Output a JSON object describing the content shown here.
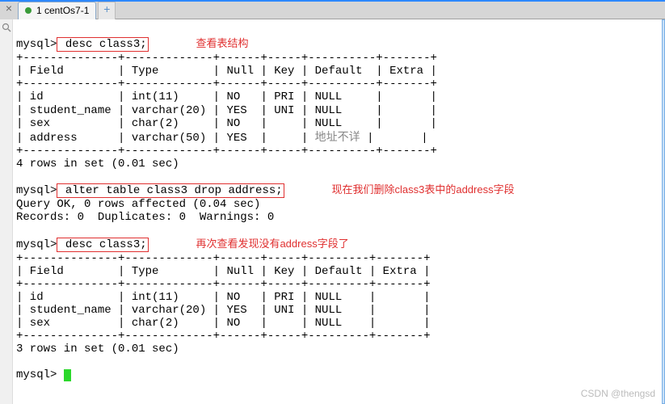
{
  "tab": {
    "label": "1 centOs7-1",
    "close": "×",
    "add": "+"
  },
  "prompts": {
    "p1": "mysql>",
    "p2": "mysql>",
    "p3": "mysql>",
    "p4": "mysql>"
  },
  "cmd1": " desc class3;",
  "anno1": "查看表结构",
  "table1": {
    "sep": "+--------------+-------------+------+-----+----------+-------+",
    "hdr": "| Field        | Type        | Null | Key | Default  | Extra |",
    "rows": [
      "| id           | int(11)     | NO   | PRI | NULL     |       |",
      "| student_name | varchar(20) | YES  | UNI | NULL     |       |",
      "| sex          | char(2)     | NO   |     | NULL     |       |"
    ],
    "row4_pre": "| address      | varchar(50) | YES  |     | ",
    "row4_def": "地址不详",
    "row4_post": " |       |"
  },
  "status1": "4 rows in set (0.01 sec)",
  "cmd2": " alter table class3 drop address;",
  "anno2": "现在我们删除class3表中的address字段",
  "result2a": "Query OK, 0 rows affected (0.04 sec)",
  "result2b": "Records: 0  Duplicates: 0  Warnings: 0",
  "cmd3": " desc class3;",
  "anno3": "再次查看发现没有address字段了",
  "table2": {
    "sep": "+--------------+-------------+------+-----+---------+-------+",
    "hdr": "| Field        | Type        | Null | Key | Default | Extra |",
    "rows": [
      "| id           | int(11)     | NO   | PRI | NULL    |       |",
      "| student_name | varchar(20) | YES  | UNI | NULL    |       |",
      "| sex          | char(2)     | NO   |     | NULL    |       |"
    ]
  },
  "status2": "3 rows in set (0.01 sec)",
  "watermark": "CSDN @thengsd"
}
